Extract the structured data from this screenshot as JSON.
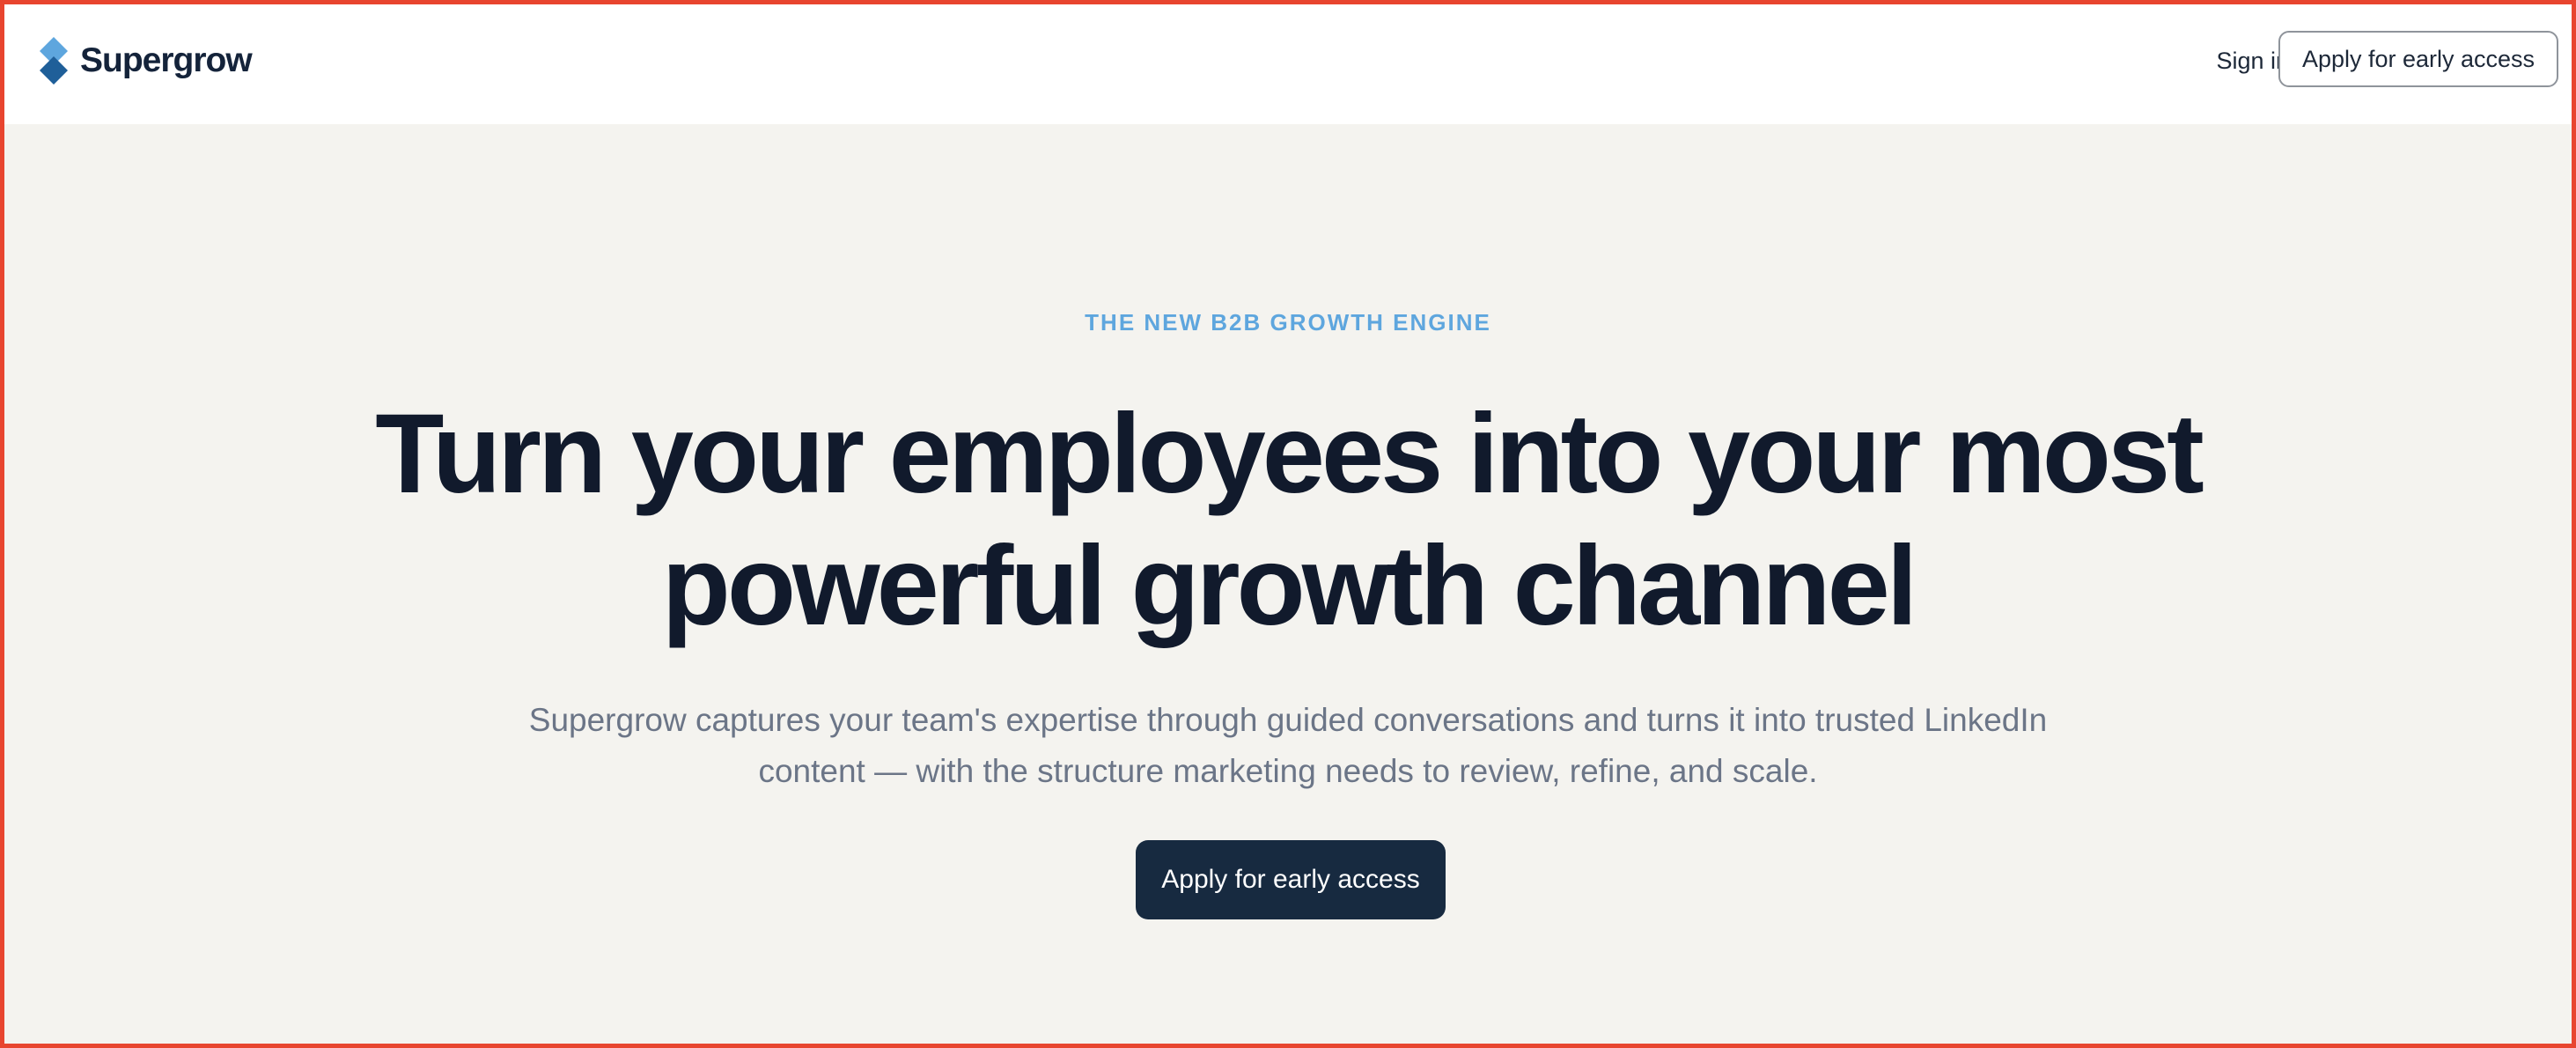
{
  "nav": {
    "brand": "Supergrow",
    "logo_icon": "supergrow-logo-icon",
    "signin_label": "Sign in",
    "cta_label": "Apply for early access"
  },
  "hero": {
    "eyebrow": "THE NEW B2B GROWTH ENGINE",
    "headline_line1": "Turn your employees into your most",
    "headline_line2": "powerful growth channel",
    "subtitle_line1": "Supergrow captures your team's expertise through guided conversations and turns it into trusted LinkedIn",
    "subtitle_line2": "content — with the structure marketing needs to review, refine, and scale.",
    "cta_label": "Apply for early access"
  },
  "colors": {
    "frame_border": "#e8452f",
    "hero_background": "#f4f3ef",
    "eyebrow": "#5ea6de",
    "headline": "#111a2c",
    "subtitle": "#6b7587",
    "primary_button": "#172a40",
    "logo_light": "#5ea6de",
    "logo_dark": "#1f5f99"
  }
}
